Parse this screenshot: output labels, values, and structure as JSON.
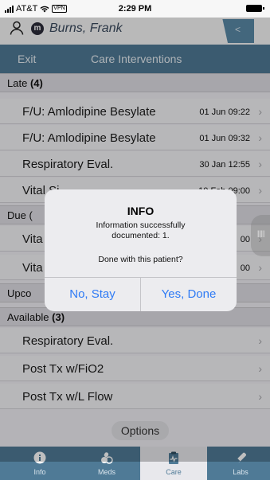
{
  "status_bar": {
    "carrier": "AT&T",
    "vpn": "VPN",
    "time": "2:29 PM"
  },
  "patient": {
    "badge": "m",
    "name": "Burns, Frank",
    "back_symbol": "<"
  },
  "nav": {
    "exit": "Exit",
    "title": "Care Interventions"
  },
  "sections": {
    "late": {
      "label": "Late",
      "count": "(4)"
    },
    "due": {
      "label": "Due ("
    },
    "upcoming": {
      "label": "Upco"
    },
    "available": {
      "label": "Available",
      "count": "(3)"
    }
  },
  "rows": [
    {
      "label": "F/U: Amlodipine Besylate",
      "time": "01 Jun 09:22"
    },
    {
      "label": "F/U: Amlodipine Besylate",
      "time": "01 Jun 09:32"
    },
    {
      "label": "Respiratory Eval.",
      "time": "30 Jan 12:55"
    },
    {
      "label": "Vital Si",
      "time": "10 Feb 09:00"
    },
    {
      "label": "Vita",
      "time": "00"
    },
    {
      "label": "Vita",
      "time": "00"
    },
    {
      "label": "Respiratory Eval.",
      "time": ""
    },
    {
      "label": "Post Tx w/FiO2",
      "time": ""
    },
    {
      "label": "Post Tx w/L Flow",
      "time": ""
    }
  ],
  "options_label": "Options",
  "tabs": [
    {
      "label": "Info",
      "icon": "info-icon"
    },
    {
      "label": "Meds",
      "icon": "pills-icon"
    },
    {
      "label": "Care",
      "icon": "clipboard-icon"
    },
    {
      "label": "Labs",
      "icon": "vial-icon"
    }
  ],
  "side_handle": "||||",
  "dialog": {
    "title": "INFO",
    "message": "Information successfully documented: 1.",
    "question": "Done with this patient?",
    "stay": "No, Stay",
    "done": "Yes, Done"
  },
  "colors": {
    "nav": "#4f7a96",
    "link": "#2f7bf5"
  }
}
